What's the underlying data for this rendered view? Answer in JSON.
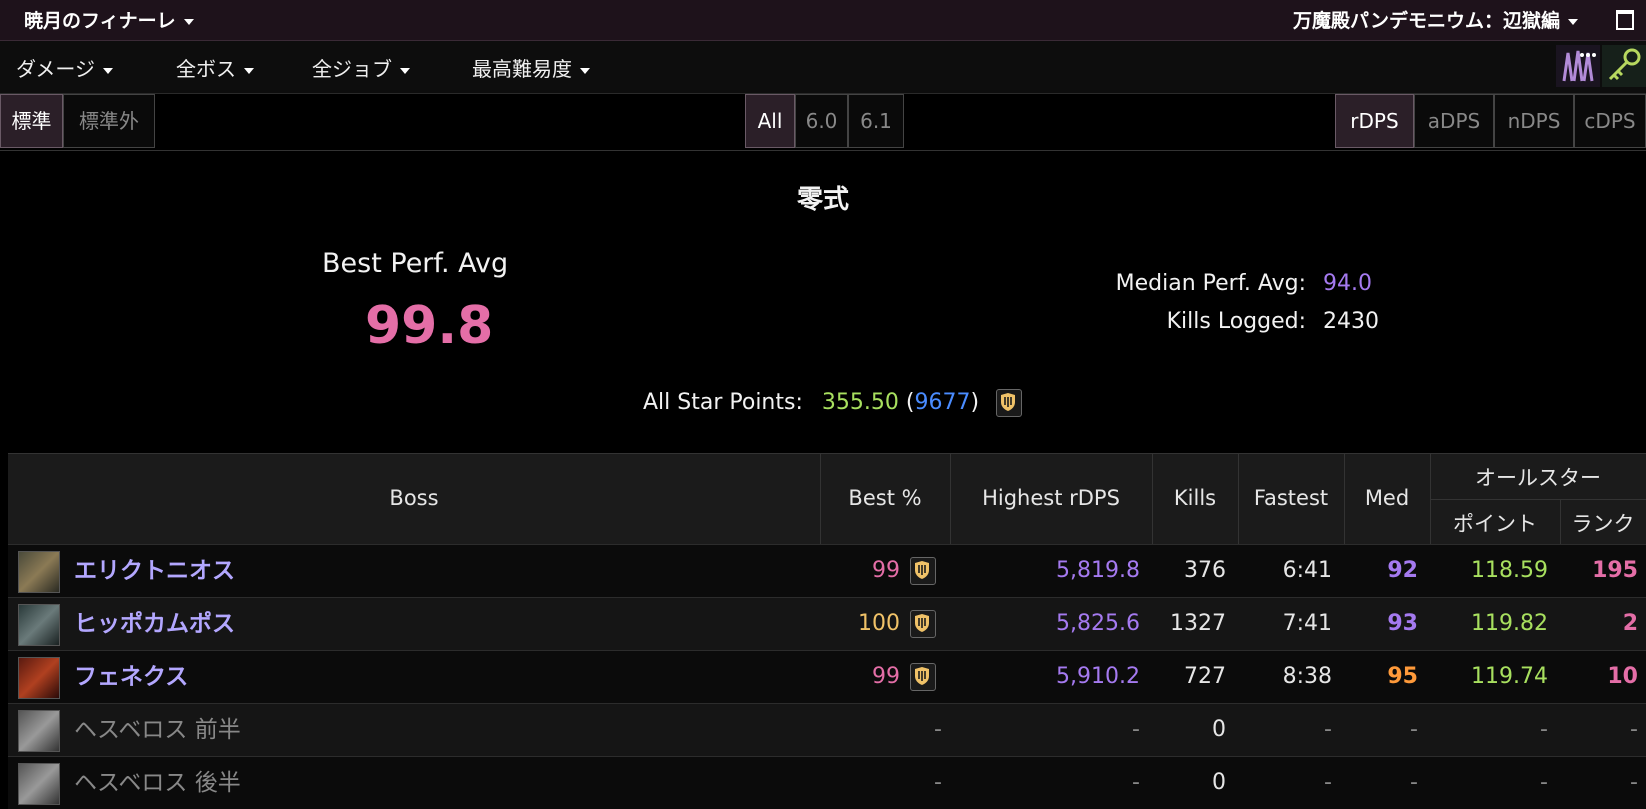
{
  "topbar": {
    "title": "暁月のフィナーレ",
    "zone": "万魔殿パンデモニウム：辺獄編"
  },
  "menu": {
    "items": [
      "ダメージ",
      "全ボス",
      "全ジョブ",
      "最高難易度"
    ]
  },
  "filters": {
    "standard": [
      "標準",
      "標準外"
    ],
    "patch": [
      "All",
      "6.0",
      "6.1"
    ],
    "metric": [
      "rDPS",
      "aDPS",
      "nDPS",
      "cDPS"
    ],
    "active": {
      "standard": "標準",
      "patch": "All",
      "metric": "rDPS"
    }
  },
  "summary": {
    "heading": "零式",
    "best_label": "Best Perf. Avg",
    "best_value": "99.8",
    "median_label": "Median Perf. Avg:",
    "median_value": "94.0",
    "kills_label": "Kills Logged:",
    "kills_value": "2430",
    "star_label": "All Star Points:",
    "star_value": "355.50",
    "star_rank_open": "(",
    "star_rank": "9677",
    "star_rank_close": ")"
  },
  "table": {
    "headers": {
      "boss": "Boss",
      "best": "Best %",
      "highest": "Highest rDPS",
      "kills": "Kills",
      "fastest": "Fastest",
      "med": "Med",
      "allstar": "オールスター",
      "points": "ポイント",
      "rank": "ランク"
    },
    "rows": [
      {
        "name": "エリクトニオス",
        "best": "99",
        "highest": "5,819.8",
        "kills": "376",
        "fastest": "6:41",
        "med": "92",
        "points": "118.59",
        "rank": "195",
        "best_color": "#e46ea7",
        "med_color": "#a57af0"
      },
      {
        "name": "ヒッポカムポス",
        "best": "100",
        "highest": "5,825.6",
        "kills": "1327",
        "fastest": "7:41",
        "med": "93",
        "points": "119.82",
        "rank": "2",
        "best_color": "#f0c268",
        "med_color": "#a57af0"
      },
      {
        "name": "フェネクス",
        "best": "99",
        "highest": "5,910.2",
        "kills": "727",
        "fastest": "8:38",
        "med": "95",
        "points": "119.74",
        "rank": "10",
        "best_color": "#e46ea7",
        "med_color": "#ff9a3a"
      },
      {
        "name": "ヘスベロス 前半",
        "best": "-",
        "highest": "-",
        "kills": "0",
        "fastest": "-",
        "med": "-",
        "points": "-",
        "rank": "-"
      },
      {
        "name": "ヘスベロス 後半",
        "best": "-",
        "highest": "-",
        "kills": "0",
        "fastest": "-",
        "med": "-",
        "points": "-",
        "rank": "-"
      }
    ]
  },
  "icons": [
    "chevron-down-icon",
    "maximize-icon",
    "job-emblem-icon",
    "key-icon",
    "shield-icon",
    "boss-portrait"
  ]
}
